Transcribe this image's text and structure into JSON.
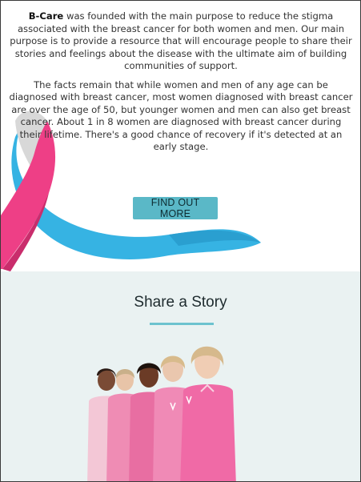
{
  "intro": {
    "brand": "B-Care",
    "para1_rest": " was founded with the main purpose to reduce the stigma associated with the breast cancer for both women and men. Our main purpose is to provide a resource that will encourage people to share their stories and feelings about the disease with the ultimate aim of building communities of support.",
    "para2": "The facts remain that while women and men of any age can be diagnosed with breast cancer, most women diagnosed with breast cancer are over the age of 50, but younger women and men can also get breast cancer. About 1 in 8 women are diagnosed with breast cancer during their lifetime. There's a good chance of recovery if it's detected at an early stage."
  },
  "cta": {
    "label": "FIND OUT MORE"
  },
  "share": {
    "title": "Share a Story"
  },
  "colors": {
    "accent": "#5ab8c7",
    "ribbon_pink": "#ee3f86",
    "ribbon_blue": "#33b3e2",
    "section_bg": "#eaf2f2"
  }
}
